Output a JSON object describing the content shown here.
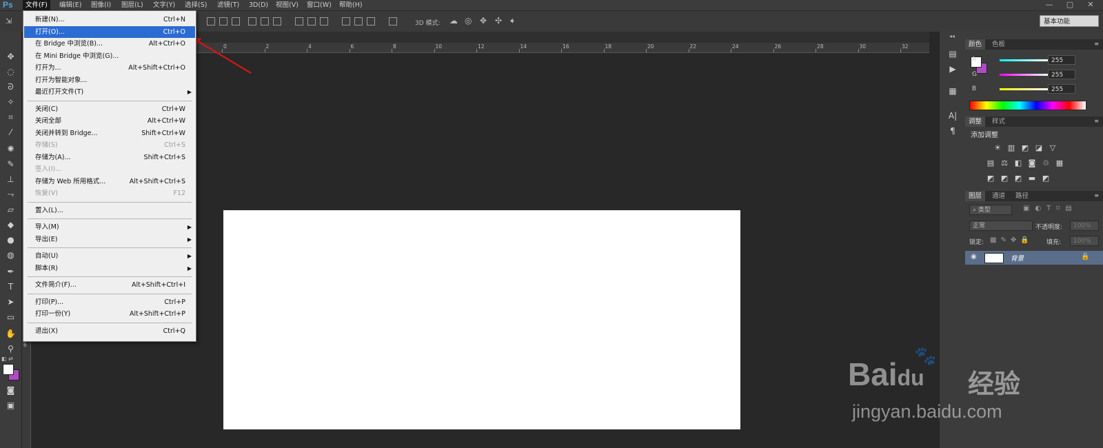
{
  "app": {
    "logo": "Ps"
  },
  "menubar": {
    "items": [
      "文件(F)",
      "编辑(E)",
      "图像(I)",
      "图层(L)",
      "文字(Y)",
      "选择(S)",
      "滤镜(T)",
      "3D(D)",
      "视图(V)",
      "窗口(W)",
      "帮助(H)"
    ],
    "window_controls": [
      "—",
      "▢",
      "✕"
    ]
  },
  "options_bar": {
    "mode_label": "3D 模式:",
    "workspace": "基本功能"
  },
  "file_menu": {
    "groups": [
      [
        {
          "label": "新建(N)...",
          "shortcut": "Ctrl+N"
        },
        {
          "label": "打开(O)...",
          "shortcut": "Ctrl+O",
          "highlighted": true
        },
        {
          "label": "在 Bridge 中浏览(B)...",
          "shortcut": "Alt+Ctrl+O"
        },
        {
          "label": "在 Mini Bridge 中浏览(G)...",
          "shortcut": ""
        },
        {
          "label": "打开为...",
          "shortcut": "Alt+Shift+Ctrl+O"
        },
        {
          "label": "打开为智能对象...",
          "shortcut": ""
        },
        {
          "label": "最近打开文件(T)",
          "shortcut": "",
          "submenu": true
        }
      ],
      [
        {
          "label": "关闭(C)",
          "shortcut": "Ctrl+W"
        },
        {
          "label": "关闭全部",
          "shortcut": "Alt+Ctrl+W"
        },
        {
          "label": "关闭并转到 Bridge...",
          "shortcut": "Shift+Ctrl+W"
        },
        {
          "label": "存储(S)",
          "shortcut": "Ctrl+S",
          "disabled": true
        },
        {
          "label": "存储为(A)...",
          "shortcut": "Shift+Ctrl+S"
        },
        {
          "label": "签入(I)...",
          "shortcut": "",
          "disabled": true
        },
        {
          "label": "存储为 Web 所用格式...",
          "shortcut": "Alt+Shift+Ctrl+S"
        },
        {
          "label": "恢复(V)",
          "shortcut": "F12",
          "disabled": true
        }
      ],
      [
        {
          "label": "置入(L)...",
          "shortcut": ""
        }
      ],
      [
        {
          "label": "导入(M)",
          "shortcut": "",
          "submenu": true
        },
        {
          "label": "导出(E)",
          "shortcut": "",
          "submenu": true
        }
      ],
      [
        {
          "label": "自动(U)",
          "shortcut": "",
          "submenu": true
        },
        {
          "label": "脚本(R)",
          "shortcut": "",
          "submenu": true
        }
      ],
      [
        {
          "label": "文件简介(F)...",
          "shortcut": "Alt+Shift+Ctrl+I"
        }
      ],
      [
        {
          "label": "打印(P)...",
          "shortcut": "Ctrl+P"
        },
        {
          "label": "打印一份(Y)",
          "shortcut": "Alt+Shift+Ctrl+P"
        }
      ],
      [
        {
          "label": "退出(X)",
          "shortcut": "Ctrl+Q"
        }
      ]
    ]
  },
  "ruler": {
    "top_ticks": [
      "0",
      "2",
      "4",
      "6",
      "8",
      "10",
      "12",
      "14",
      "16",
      "18",
      "20",
      "22",
      "24",
      "26",
      "28",
      "30",
      "32"
    ],
    "left_ticks": [
      "6"
    ]
  },
  "color_panel": {
    "tabs": [
      "颜色",
      "色板"
    ],
    "channels": [
      {
        "name": "R",
        "value": "255"
      },
      {
        "name": "G",
        "value": "255"
      },
      {
        "name": "B",
        "value": "255"
      }
    ],
    "foreground": "#ffffff",
    "background": "#b04bc4"
  },
  "adjust_panel": {
    "tabs": [
      "调整",
      "样式"
    ],
    "title": "添加调整"
  },
  "layers_panel": {
    "tabs": [
      "图层",
      "通道",
      "路径"
    ],
    "filter": "类型",
    "blend_mode": "正常",
    "opacity_label": "不透明度:",
    "opacity": "100%",
    "lock_label": "锁定:",
    "fill_label": "填充:",
    "fill": "100%",
    "layers": [
      {
        "name": "背景",
        "locked": true
      }
    ]
  },
  "watermark": {
    "brand": "Bai",
    "brand2": "du",
    "cn": "经验",
    "url": "jingyan.baidu.com"
  },
  "colors": {
    "accent": "#2b6bd2",
    "arrow": "#d01818"
  }
}
